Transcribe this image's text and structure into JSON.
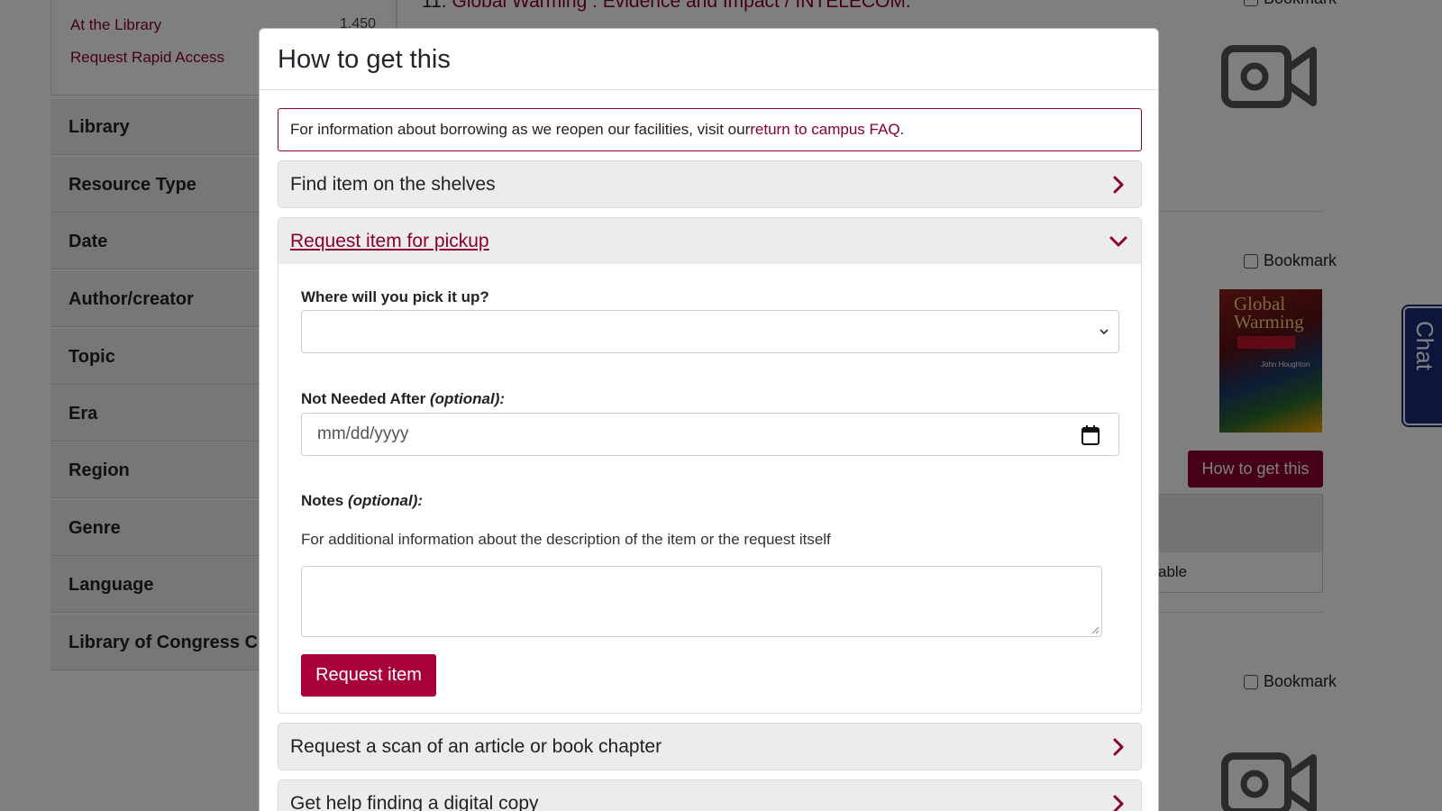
{
  "background": {
    "facets_top": {
      "at_library": "At the Library",
      "at_library_count": "1,450",
      "request_rapid": "Request Rapid Access"
    },
    "facets": [
      "Library",
      "Resource Type",
      "Date",
      "Author/creator",
      "Topic",
      "Era",
      "Region",
      "Genre",
      "Language",
      "Library of Congress Cla"
    ],
    "result_title_num": "11.",
    "result_title": "Global Warming : Evidence and Impact / INTELECOM.",
    "bookmark_label": "Bookmark",
    "book_cover": {
      "title": "Global Warming",
      "author": "John Houghton"
    },
    "how_button": "How to get this",
    "availability_text": "able",
    "chat_label": "Chat"
  },
  "modal": {
    "title": "How to get this",
    "alert": {
      "text": "For information about borrowing as we reopen our facilities, visit our ",
      "link": "return to campus FAQ",
      "suffix": "."
    },
    "sections": {
      "find": "Find item on the shelves",
      "pickup": "Request item for pickup",
      "scan": "Request a scan of an article or book chapter",
      "digital": "Get help finding a digital copy"
    },
    "form": {
      "pickup_label": "Where will you pick it up?",
      "pickup_value": "",
      "not_needed_label": "Not Needed After",
      "optional": "(optional):",
      "date_placeholder": "mm/dd/yyyy",
      "notes_label": "Notes",
      "notes_help": "For additional information about the description of the item or the request itself",
      "submit": "Request item"
    }
  },
  "colors": {
    "brand": "#8a0030",
    "button": "#a8003a",
    "overlay": "rgba(0,0,0,0.5)"
  }
}
